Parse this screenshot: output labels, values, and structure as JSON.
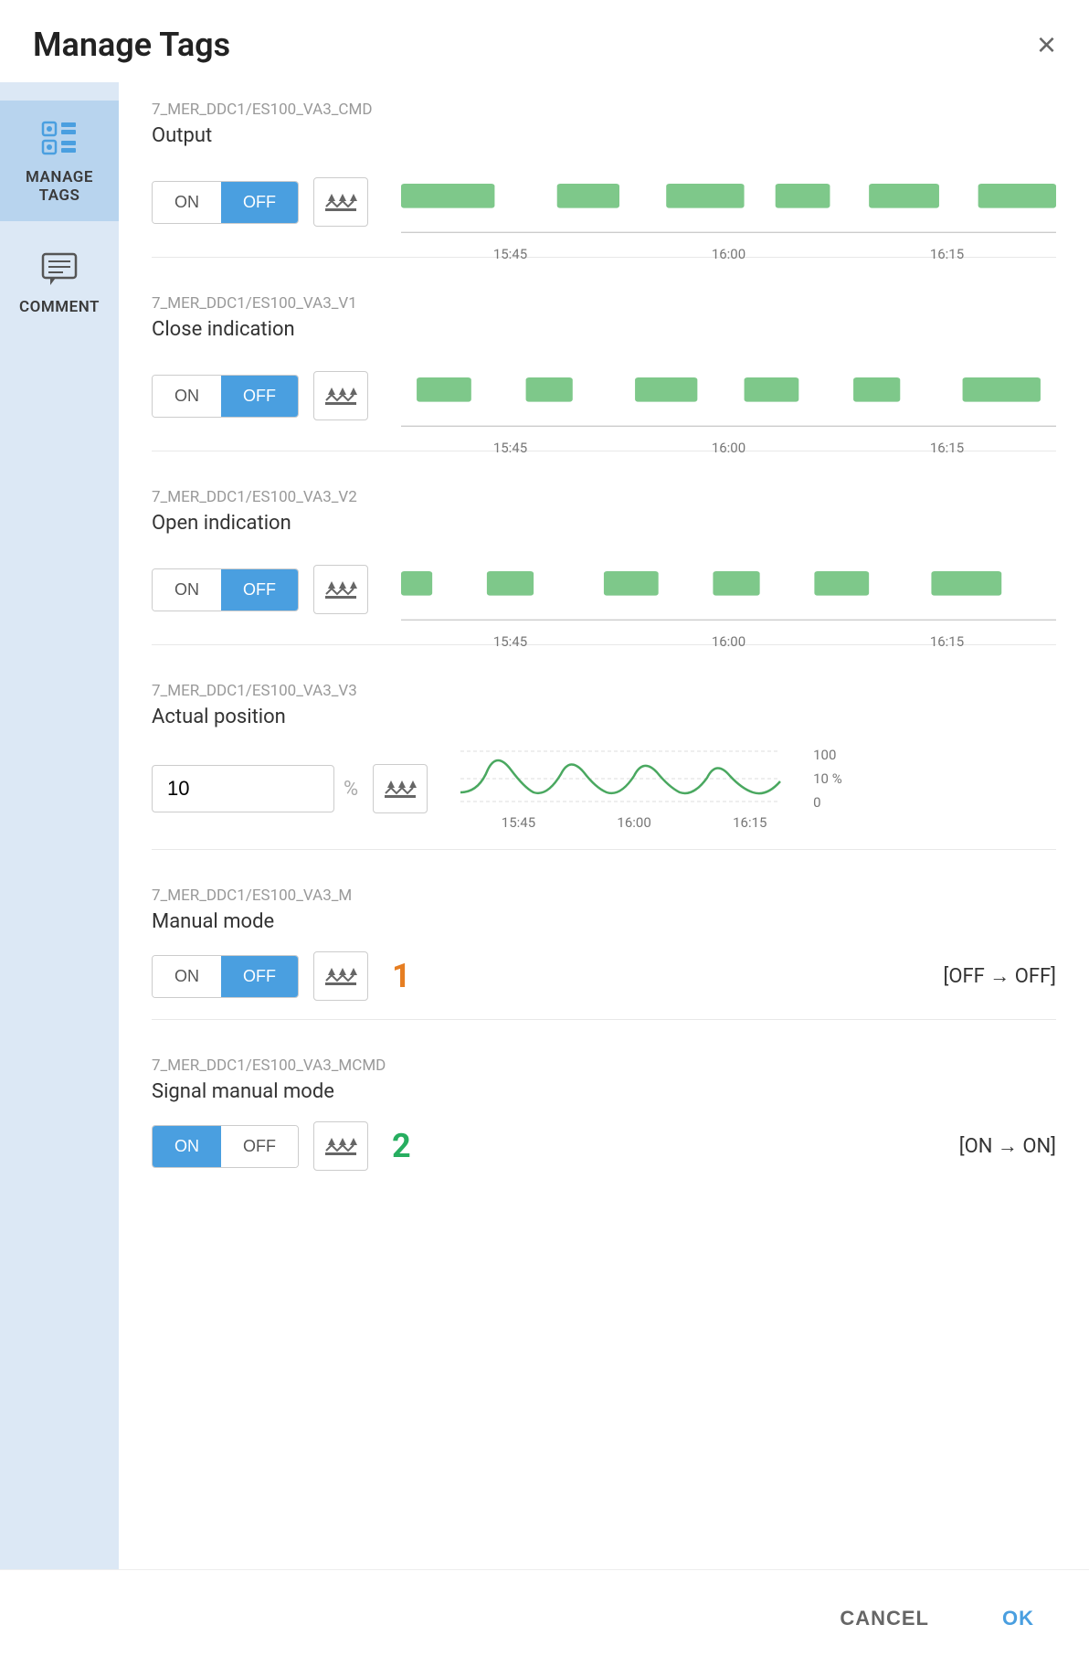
{
  "dialog": {
    "title": "Manage Tags",
    "close_label": "×"
  },
  "sidebar": {
    "items": [
      {
        "id": "manage-tags",
        "label": "MANAGE TAGS",
        "active": true
      },
      {
        "id": "comment",
        "label": "COMMENT",
        "active": false
      }
    ]
  },
  "tags": [
    {
      "id": "tag1",
      "path": "7_MER_DDC1/ES100_VA3_CMD",
      "name": "Output",
      "type": "toggle",
      "on_active": false,
      "off_active": true,
      "has_chart": true,
      "chart_type": "bar",
      "chart_labels": [
        "15:45",
        "16:00",
        "16:15"
      ]
    },
    {
      "id": "tag2",
      "path": "7_MER_DDC1/ES100_VA3_V1",
      "name": "Close indication",
      "type": "toggle",
      "on_active": false,
      "off_active": true,
      "has_chart": true,
      "chart_type": "bar",
      "chart_labels": [
        "15:45",
        "16:00",
        "16:15"
      ]
    },
    {
      "id": "tag3",
      "path": "7_MER_DDC1/ES100_VA3_V2",
      "name": "Open indication",
      "type": "toggle",
      "on_active": false,
      "off_active": true,
      "has_chart": true,
      "chart_type": "bar",
      "chart_labels": [
        "15:45",
        "16:00",
        "16:15"
      ]
    },
    {
      "id": "tag4",
      "path": "7_MER_DDC1/ES100_VA3_V3",
      "name": "Actual position",
      "type": "numeric",
      "value": "10",
      "unit": "%",
      "has_chart": true,
      "chart_type": "line",
      "chart_labels": [
        "15:45",
        "16:00",
        "16:15"
      ],
      "chart_range_high": "100",
      "chart_range_low": "0",
      "chart_range_mid": "10 %"
    },
    {
      "id": "tag5",
      "path": "7_MER_DDC1/ES100_VA3_M",
      "name": "Manual mode",
      "type": "toggle",
      "on_active": false,
      "off_active": true,
      "has_chart": false,
      "badge": "1",
      "badge_color": "orange",
      "state_label": "[OFF → OFF]"
    },
    {
      "id": "tag6",
      "path": "7_MER_DDC1/ES100_VA3_MCMD",
      "name": "Signal manual mode",
      "type": "toggle",
      "on_active": true,
      "off_active": false,
      "has_chart": false,
      "badge": "2",
      "badge_color": "green",
      "state_label": "[ON → ON]"
    }
  ],
  "footer": {
    "cancel_label": "CANCEL",
    "ok_label": "OK"
  }
}
